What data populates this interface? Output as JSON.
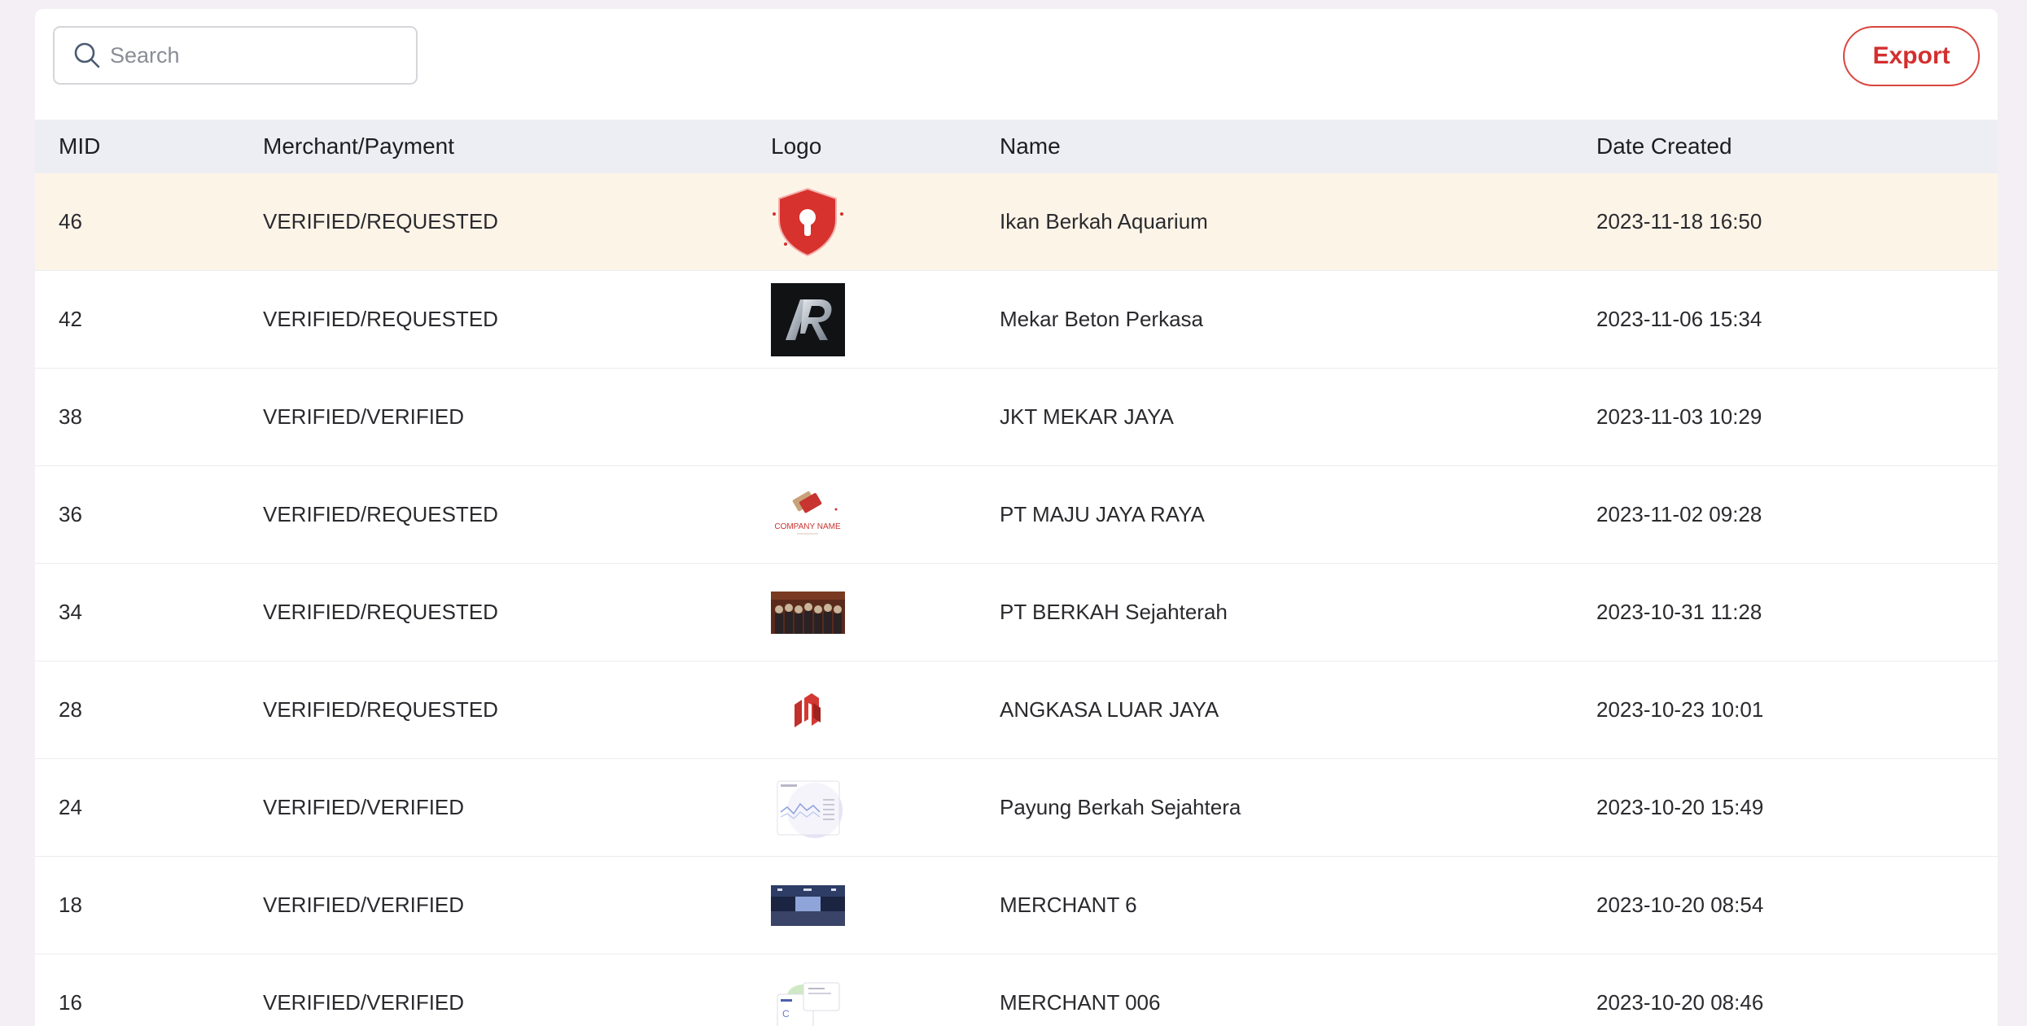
{
  "search": {
    "placeholder": "Search",
    "value": ""
  },
  "toolbar": {
    "export_label": "Export"
  },
  "table": {
    "headers": {
      "mid": "MID",
      "merchant_payment": "Merchant/Payment",
      "logo": "Logo",
      "name": "Name",
      "date_created": "Date Created"
    },
    "rows": [
      {
        "mid": "46",
        "status": "VERIFIED/REQUESTED",
        "logo": "red-shield-keyhole-logo",
        "name": "Ikan Berkah Aquarium",
        "date": "2023-11-18 16:50"
      },
      {
        "mid": "42",
        "status": "VERIFIED/REQUESTED",
        "logo": "ar-monogram-logo",
        "name": "Mekar Beton Perkasa",
        "date": "2023-11-06 15:34"
      },
      {
        "mid": "38",
        "status": "VERIFIED/VERIFIED",
        "logo": "none",
        "name": "JKT MEKAR JAYA",
        "date": "2023-11-03 10:29"
      },
      {
        "mid": "36",
        "status": "VERIFIED/REQUESTED",
        "logo": "company-name-logo",
        "logo_text": "COMPANY NAME",
        "name": "PT MAJU JAYA RAYA",
        "date": "2023-11-02 09:28"
      },
      {
        "mid": "34",
        "status": "VERIFIED/REQUESTED",
        "logo": "group-photo-logo",
        "name": "PT BERKAH Sejahterah",
        "date": "2023-10-31 11:28"
      },
      {
        "mid": "28",
        "status": "VERIFIED/REQUESTED",
        "logo": "red-geometric-logo",
        "name": "ANGKASA LUAR JAYA",
        "date": "2023-10-23 10:01"
      },
      {
        "mid": "24",
        "status": "VERIFIED/VERIFIED",
        "logo": "dashboard-screenshot-logo",
        "name": "Payung Berkah Sejahtera",
        "date": "2023-10-20 15:49"
      },
      {
        "mid": "18",
        "status": "VERIFIED/VERIFIED",
        "logo": "stage-photo-logo",
        "name": "MERCHANT 6",
        "date": "2023-10-20 08:54"
      },
      {
        "mid": "16",
        "status": "VERIFIED/VERIFIED",
        "logo": "app-screenshot-logo",
        "name": "MERCHANT 006",
        "date": "2023-10-20 08:46"
      }
    ]
  },
  "colors": {
    "accent": "#d32f2f",
    "header_bg": "#edeef3",
    "highlight_row": "#fdf4e8",
    "page_bg": "#f3eff4"
  }
}
